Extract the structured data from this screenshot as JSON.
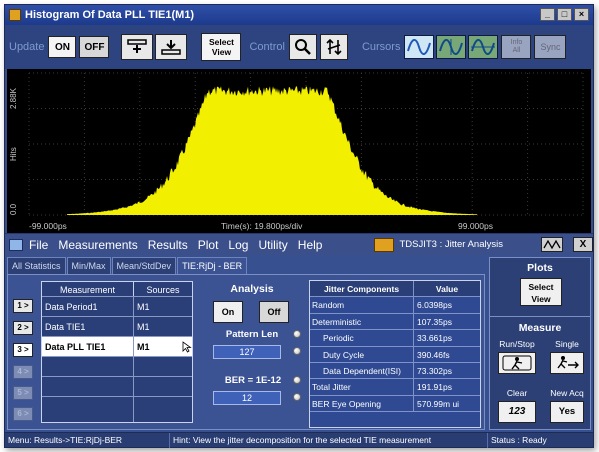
{
  "window": {
    "title": "Histogram Of Data PLL TIE1(M1)",
    "buttons": [
      "_",
      "□",
      "×"
    ]
  },
  "toolbar": {
    "update_label": "Update",
    "on_label": "ON",
    "off_label": "OFF",
    "select_view_label_1": "Select",
    "select_view_label_2": "View",
    "control_label": "Control",
    "cursors_label": "Cursors",
    "info_label_1": "Info",
    "info_label_2": "All",
    "sync_label": "Sync"
  },
  "plot": {
    "y_unit": "Hits",
    "y_top_label": "2.88K",
    "y_bottom_label": "0.0",
    "x_left_label": "-99.000ps",
    "x_center_label": "Time(s): 19.800ps/div",
    "x_right_label": "99.000ps",
    "fill_color": "#f2ef00",
    "grid_color": "#3a3a3a"
  },
  "menu": {
    "items": [
      "File",
      "Measurements",
      "Results",
      "Plot",
      "Log",
      "Utility",
      "Help"
    ],
    "app_name": "TDSJIT3 : Jitter Analysis",
    "close_label": "X"
  },
  "tabs": [
    "All Statistics",
    "Min/Max",
    "Mean/StdDev",
    "TIE:RjDj - BER"
  ],
  "side_buttons": [
    "1 >",
    "2 >",
    "3 >",
    "4 >",
    "5 >",
    "6 >"
  ],
  "measurements": {
    "headers": [
      "Measurement",
      "Sources"
    ],
    "rows": [
      {
        "name": "Data Period1",
        "source": "M1"
      },
      {
        "name": "Data TIE1",
        "source": "M1"
      },
      {
        "name": "Data PLL TIE1",
        "source": "M1"
      }
    ]
  },
  "analysis": {
    "title": "Analysis",
    "on_label": "On",
    "off_label": "Off",
    "pattern_len_label": "Pattern Len",
    "pattern_len_value": "127",
    "ber_label": "BER = 1E-",
    "ber_value": "12"
  },
  "jitter_table": {
    "headers": [
      "Jitter Components",
      "Value"
    ],
    "rows": [
      {
        "name": "Random",
        "value": "6.0398ps",
        "indent": false
      },
      {
        "name": "Deterministic",
        "value": "107.35ps",
        "indent": false
      },
      {
        "name": "Periodic",
        "value": "33.661ps",
        "indent": true
      },
      {
        "name": "Duty Cycle",
        "value": "390.46fs",
        "indent": true
      },
      {
        "name": "Data Dependent(ISI)",
        "value": "73.302ps",
        "indent": true
      },
      {
        "name": "Total Jitter",
        "value": "191.91ps",
        "indent": false
      },
      {
        "name": "BER Eye Opening",
        "value": "570.99m ui",
        "indent": false
      }
    ]
  },
  "right_panel": {
    "plots_title": "Plots",
    "select_view_1": "Select",
    "select_view_2": "View",
    "measure_title": "Measure",
    "run_stop_label": "Run/Stop",
    "single_label": "Single",
    "clear_label": "Clear",
    "new_acq_label": "New Acq",
    "clear_btn_text": "123",
    "yes_label": "Yes"
  },
  "status": {
    "menu_path": "Menu: Results->TIE:RjDj-BER",
    "hint": "Hint: View the jitter decomposition for the selected TIE measurement",
    "status": "Status : Ready"
  }
}
